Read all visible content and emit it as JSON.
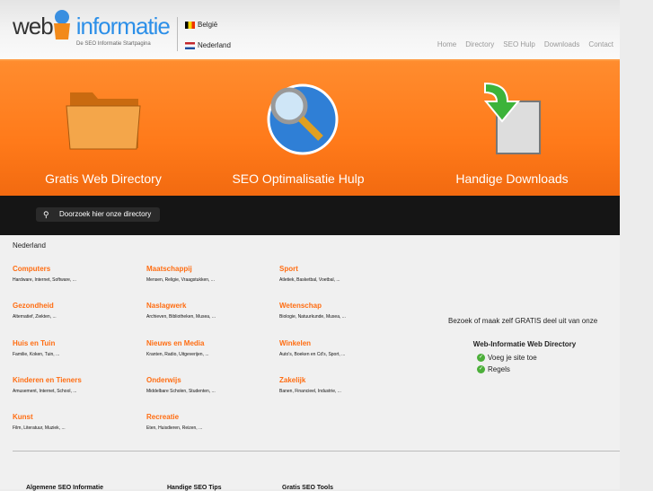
{
  "header": {
    "logo_web": "web",
    "logo_info": "informatie",
    "tagline": "De SEO Informatie Startpagina",
    "lang_be": "België",
    "lang_nl": "Nederland",
    "nav": [
      "Home",
      "Directory",
      "SEO Hulp",
      "Downloads",
      "Contact"
    ]
  },
  "banner": {
    "features": [
      "Gratis Web Directory",
      "SEO Optimalisatie Hulp",
      "Handige Downloads"
    ]
  },
  "search": {
    "placeholder": "Doorzoek hier onze directory"
  },
  "breadcrumb": "Nederland",
  "categories": [
    {
      "title": "Computers",
      "sub": "Hardware, Internet, Software, ..."
    },
    {
      "title": "Maatschappij",
      "sub": "Mensen, Religie, Vraagstukken, ..."
    },
    {
      "title": "Sport",
      "sub": "Atletiek, Basketbal, Voetbal, ..."
    },
    {
      "title": "Gezondheid",
      "sub": "Alternatief, Ziekten, ..."
    },
    {
      "title": "Naslagwerk",
      "sub": "Archieven, Bibliotheken, Musea, ..."
    },
    {
      "title": "Wetenschap",
      "sub": "Biologie, Natuurkunde, Musea, ..."
    },
    {
      "title": "Huis en Tuin",
      "sub": "Familie, Koken, Tuin, ..."
    },
    {
      "title": "Nieuws en Media",
      "sub": "Kranten, Radio, Uitgeverijen, ..."
    },
    {
      "title": "Winkelen",
      "sub": "Auto's, Boeken en Cd's, Sport, ..."
    },
    {
      "title": "Kinderen en Tieners",
      "sub": "Amusement, Internet, School, ..."
    },
    {
      "title": "Onderwijs",
      "sub": "Middelbare Scholen, Studenten, ..."
    },
    {
      "title": "Zakelijk",
      "sub": "Banen, Financieel, Industrie, ..."
    },
    {
      "title": "Kunst",
      "sub": "Film, Literatuur, Muziek, ..."
    },
    {
      "title": "Recreatie",
      "sub": "Eten, Huisdieren, Reizen, ..."
    }
  ],
  "promo": {
    "text": "Bezoek of maak zelf GRATIS deel uit van onze",
    "heading": "Web-Informatie Web Directory",
    "links": [
      "Voeg je site toe",
      "Regels"
    ]
  },
  "footer": [
    "Algemene SEO Informatie",
    "Handige SEO Tips",
    "Gratis SEO Tools"
  ]
}
